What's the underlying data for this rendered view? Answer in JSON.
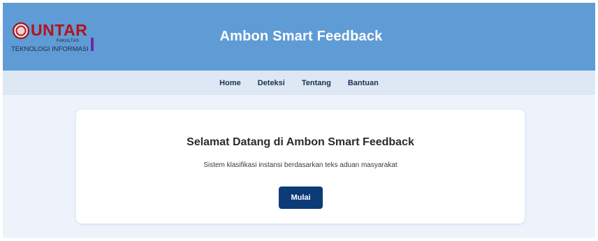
{
  "header": {
    "logo": {
      "wordmark": "UNTAR",
      "faculty_label": "FAKULTAS",
      "subtitle": "TEKNOLOGI INFORMASI"
    },
    "title": "Ambon Smart Feedback"
  },
  "nav": {
    "items": [
      "Home",
      "Deteksi",
      "Tentang",
      "Bantuan"
    ]
  },
  "main": {
    "heading": "Selamat Datang di Ambon Smart Feedback",
    "description": "Sistem klasifikasi instansi berdasarkan teks aduan masyarakat",
    "cta_label": "Mulai"
  },
  "colors": {
    "header_bg": "#5f9bd5",
    "nav_bg": "#dde8f4",
    "page_bg": "#eef3fb",
    "button_bg": "#0c3b78",
    "logo_red": "#b5121b"
  }
}
